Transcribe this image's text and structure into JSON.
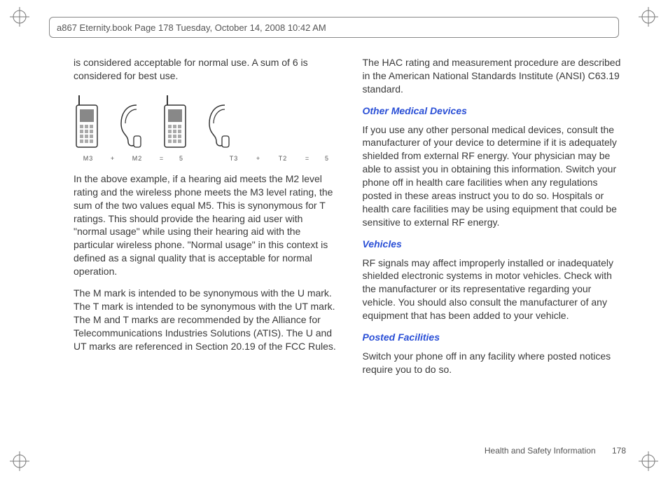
{
  "header": {
    "text": "a867 Eternity.book  Page 178  Tuesday, October 14, 2008  10:42 AM"
  },
  "left": {
    "intro": "is considered acceptable for normal use. A sum of 6 is considered for best use.",
    "equation": {
      "m_phone": "M3",
      "plus1": "+",
      "m_aid": "M2",
      "eq1": "=",
      "m_sum": "5",
      "t_phone": "T3",
      "plus2": "+",
      "t_aid": "T2",
      "eq2": "=",
      "t_sum": "5"
    },
    "para2": "In the above example, if a hearing aid meets the M2 level rating and the wireless phone meets the M3 level rating, the sum of the two values equal M5. This is synonymous for T ratings. This should provide the hearing aid user with \"normal usage\" while using their hearing aid with the particular wireless phone. \"Normal usage\" in this context is defined as a signal quality that is acceptable for normal operation.",
    "para3": "The M mark is intended to be synonymous with the U mark. The T mark is intended to be synonymous with the UT mark. The M and T marks are recommended by the Alliance for Telecommunications Industries Solutions (ATIS). The U and UT marks are referenced in Section 20.19 of the FCC Rules."
  },
  "right": {
    "para1": "The HAC rating and measurement procedure are described in the American National Standards Institute (ANSI) C63.19 standard.",
    "head1": "Other Medical Devices",
    "para2": "If you use any other personal medical devices, consult the manufacturer of your device to determine if it is adequately shielded from external RF energy. Your physician may be able to assist you in obtaining this information. Switch your phone off in health care facilities when any regulations posted in these areas instruct you to do so. Hospitals or health care facilities may be using equipment that could be sensitive to external RF energy.",
    "head2": "Vehicles",
    "para3": "RF signals may affect improperly installed or inadequately shielded electronic systems in motor vehicles. Check with the manufacturer or its representative regarding your vehicle. You should also consult the manufacturer of any equipment that has been added to your vehicle.",
    "head3": "Posted Facilities",
    "para4": "Switch your phone off in any facility where posted notices require you to do so."
  },
  "footer": {
    "section": "Health and Safety Information",
    "page": "178"
  }
}
